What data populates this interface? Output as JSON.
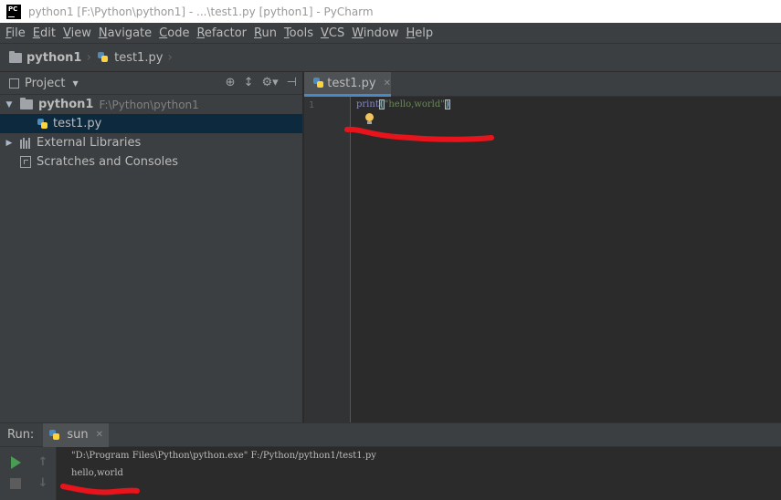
{
  "window": {
    "title": "python1 [F:\\Python\\python1] - ...\\test1.py [python1] - PyCharm",
    "app_icon_text": "PC"
  },
  "menu": [
    {
      "mnemonic": "F",
      "rest": "ile"
    },
    {
      "mnemonic": "E",
      "rest": "dit"
    },
    {
      "mnemonic": "V",
      "rest": "iew"
    },
    {
      "mnemonic": "N",
      "rest": "avigate"
    },
    {
      "mnemonic": "C",
      "rest": "ode"
    },
    {
      "mnemonic": "R",
      "rest": "efactor"
    },
    {
      "mnemonic": "R",
      "rest": "un"
    },
    {
      "mnemonic": "T",
      "rest": "ools"
    },
    {
      "mnemonic": "V",
      "rest": "CS"
    },
    {
      "mnemonic": "W",
      "rest": "indow"
    },
    {
      "mnemonic": "H",
      "rest": "elp"
    }
  ],
  "breadcrumb": {
    "project": "python1",
    "file": "test1.py"
  },
  "project_panel": {
    "title": "Project",
    "tree": {
      "root_name": "python1",
      "root_path": "F:\\Python\\python1",
      "file": "test1.py",
      "external_libraries": "External Libraries",
      "scratches": "Scratches and Consoles"
    }
  },
  "editor": {
    "tab_label": "test1.py",
    "line_number": "1",
    "code": {
      "keyword": "print",
      "open_paren": "(",
      "string": "\"hello,world\"",
      "close_paren": ")"
    }
  },
  "run_panel": {
    "label": "Run:",
    "tab_label": "sun",
    "console": {
      "command": "\"D:\\Program Files\\Python\\python.exe\" F:/Python/python1/test1.py",
      "output": "hello,world"
    }
  },
  "colors": {
    "annotation": "#e8141b",
    "accent_selection": "#0d293e",
    "run_green": "#499c54"
  }
}
